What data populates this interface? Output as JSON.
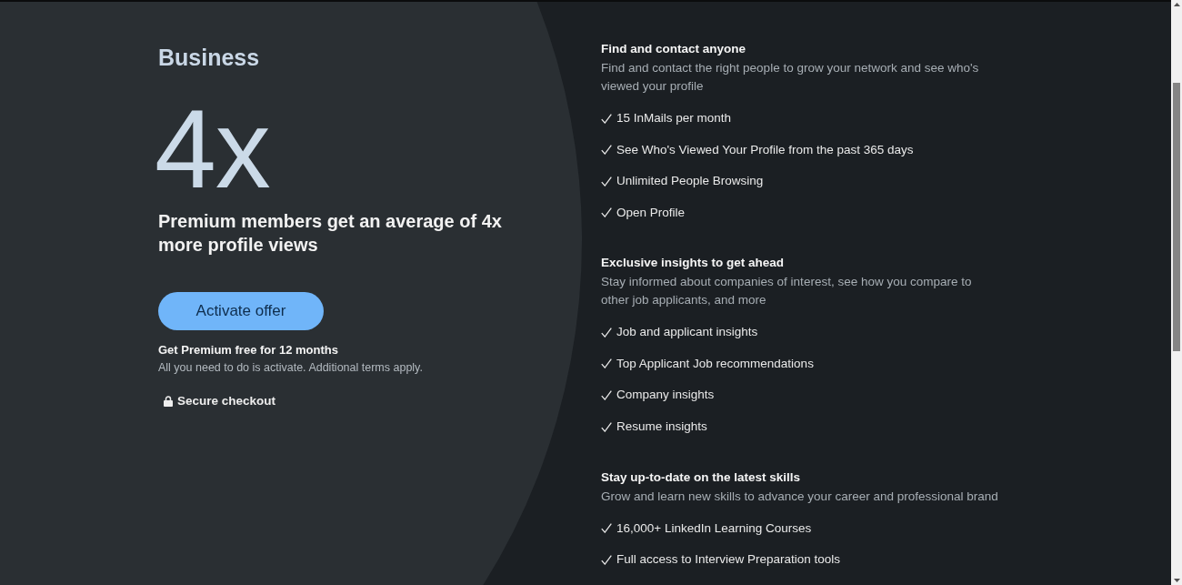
{
  "offer": {
    "plan": "Business",
    "stat": "4x",
    "headline": "Premium members get an average of 4x more profile views",
    "button": "Activate offer",
    "promo_title": "Get Premium free for 12 months",
    "promo_note": "All you need to do is activate. Additional terms apply.",
    "secure_label": "Secure checkout"
  },
  "sections": [
    {
      "title": "Find and contact anyone",
      "description": "Find and contact the right people to grow your network and see who's viewed your profile",
      "features": [
        "15 InMails per month",
        "See Who's Viewed Your Profile from the past 365 days",
        "Unlimited People Browsing",
        "Open Profile"
      ]
    },
    {
      "title": "Exclusive insights to get ahead",
      "description": "Stay informed about companies of interest, see how you compare to other job applicants, and more",
      "features": [
        "Job and applicant insights",
        "Top Applicant Job recommendations",
        "Company insights",
        "Resume insights"
      ]
    },
    {
      "title": "Stay up-to-date on the latest skills",
      "description": "Grow and learn new skills to advance your career and professional brand",
      "features": [
        "16,000+ LinkedIn Learning Courses",
        "Full access to Interview Preparation tools"
      ]
    }
  ]
}
